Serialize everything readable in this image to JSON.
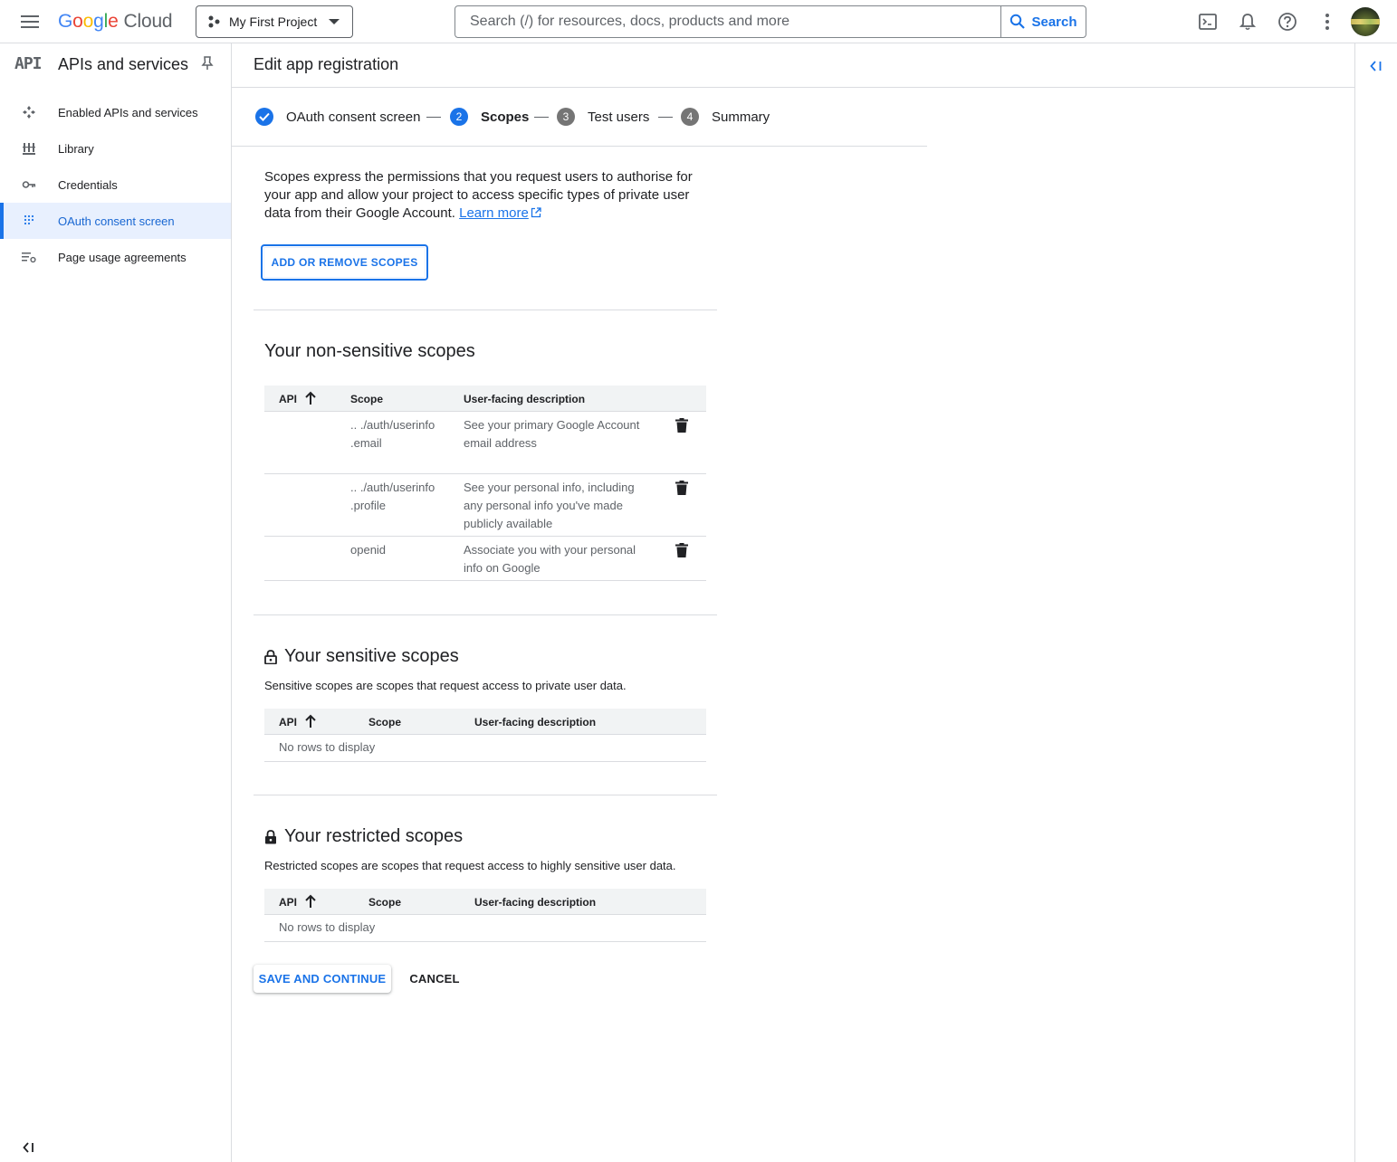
{
  "topbar": {
    "logo": {
      "g1": "G",
      "g2": "o",
      "g3": "o",
      "g4": "g",
      "g5": "l",
      "g6": "e",
      "cloud": "Cloud"
    },
    "project": "My First Project",
    "search_placeholder": "Search (/) for resources, docs, products and more",
    "search_button": "Search",
    "icons": [
      "menu-icon",
      "terminal-icon",
      "bell-icon",
      "help-icon",
      "more-vert-icon"
    ]
  },
  "sidebar": {
    "badge": "API",
    "title": "APIs and services",
    "items": [
      {
        "label": "Enabled APIs and services",
        "icon": "enabled-apis-icon"
      },
      {
        "label": "Library",
        "icon": "library-icon"
      },
      {
        "label": "Credentials",
        "icon": "key-icon"
      },
      {
        "label": "OAuth consent screen",
        "icon": "oauth-icon",
        "active": true
      },
      {
        "label": "Page usage agreements",
        "icon": "settings-list-icon"
      }
    ]
  },
  "page": {
    "title": "Edit app registration",
    "steps": [
      {
        "label": "OAuth consent screen",
        "state": "done"
      },
      {
        "num": "2",
        "label": "Scopes",
        "state": "current"
      },
      {
        "num": "3",
        "label": "Test users",
        "state": "todo"
      },
      {
        "num": "4",
        "label": "Summary",
        "state": "todo"
      }
    ],
    "intro": "Scopes express the permissions that you request users to authorise for your app and allow your project to access specific types of private user data from their Google Account.",
    "learn_more": "Learn more",
    "add_remove_button": "ADD OR REMOVE SCOPES",
    "columns": {
      "api": "API",
      "scope": "Scope",
      "description": "User-facing description"
    },
    "non_sensitive": {
      "title": "Your non-sensitive scopes",
      "rows": [
        {
          "scope": ".. ./auth/userinfo .email",
          "description": "See your primary Google Account email address"
        },
        {
          "scope": ".. ./auth/userinfo .profile",
          "description": "See your personal info, including any personal info you've made publicly available"
        },
        {
          "scope": "openid",
          "description": "Associate you with your personal info on Google"
        }
      ]
    },
    "sensitive": {
      "title": "Your sensitive scopes",
      "description": "Sensitive scopes are scopes that request access to private user data.",
      "empty": "No rows to display"
    },
    "restricted": {
      "title": "Your restricted scopes",
      "description": "Restricted scopes are scopes that request access to highly sensitive user data.",
      "empty": "No rows to display"
    },
    "save_button": "SAVE AND CONTINUE",
    "cancel_button": "CANCEL"
  },
  "colors": {
    "accent": "#1a73e8",
    "active_bg": "#e8f0fe",
    "border": "#dadce0"
  }
}
